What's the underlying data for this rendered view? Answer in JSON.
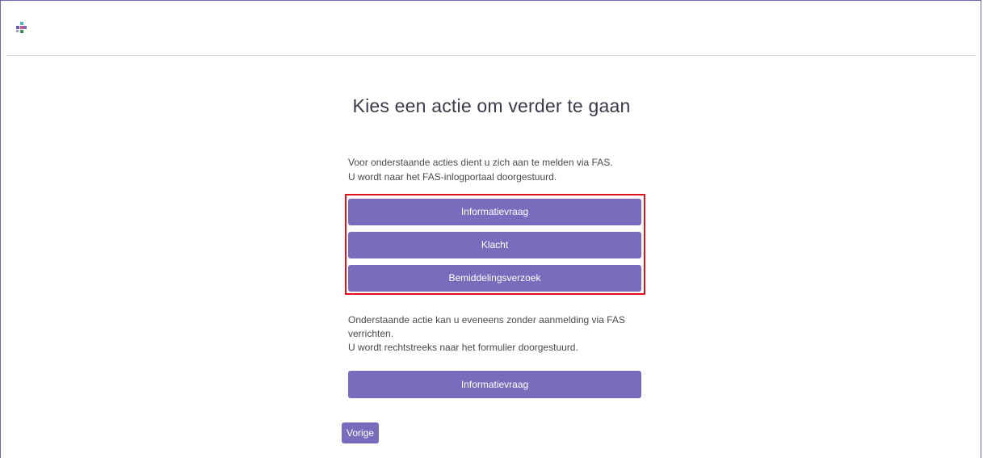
{
  "page": {
    "title": "Kies een actie om verder te gaan"
  },
  "fas_section": {
    "line1": "Voor onderstaande acties dient u zich aan te melden via FAS.",
    "line2": "U wordt naar het FAS-inlogportaal doorgestuurd.",
    "buttons": [
      {
        "label": "Informatievraag"
      },
      {
        "label": "Klacht"
      },
      {
        "label": "Bemiddelingsverzoek"
      }
    ]
  },
  "direct_section": {
    "line1": "Onderstaande actie kan u eveneens zonder aanmelding via FAS",
    "line2": "verrichten.",
    "line3": "U wordt rechtstreeks naar het formulier doorgestuurd.",
    "button": {
      "label": "Informatievraag"
    }
  },
  "footer": {
    "back_label": "Vorige"
  },
  "colors": {
    "accent": "#7a6cbd",
    "highlight": "#e0111b"
  },
  "icons": {
    "logo": "brand-logo-icon"
  }
}
